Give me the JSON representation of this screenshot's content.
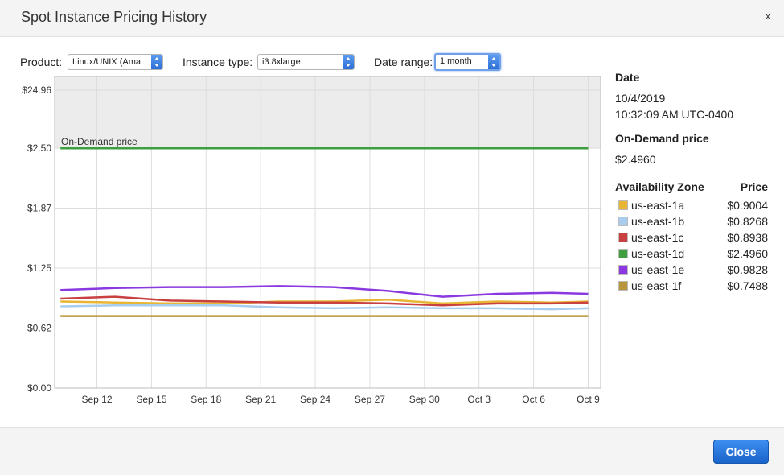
{
  "dialog": {
    "title": "Spot Instance Pricing History",
    "close_glyph": "x"
  },
  "controls": {
    "product": {
      "label": "Product:",
      "value": "Linux/UNIX (Ama"
    },
    "instance_type": {
      "label": "Instance type:",
      "value": "i3.8xlarge"
    },
    "date_range": {
      "label": "Date range:",
      "value": "1 month"
    }
  },
  "details": {
    "date_heading": "Date",
    "date": "10/4/2019",
    "time": "10:32:09 AM UTC-0400",
    "on_demand_heading": "On-Demand price",
    "on_demand_price": "$2.4960",
    "az_heading": "Availability Zone",
    "price_heading": "Price",
    "zones": [
      {
        "name": "us-east-1a",
        "price": "$0.9004",
        "color": "#e8b534"
      },
      {
        "name": "us-east-1b",
        "price": "$0.8268",
        "color": "#a9cdee"
      },
      {
        "name": "us-east-1c",
        "price": "$0.8938",
        "color": "#c94040"
      },
      {
        "name": "us-east-1d",
        "price": "$2.4960",
        "color": "#3f9e3f"
      },
      {
        "name": "us-east-1e",
        "price": "$0.9828",
        "color": "#8a38e0"
      },
      {
        "name": "us-east-1f",
        "price": "$0.7488",
        "color": "#b8963c"
      }
    ]
  },
  "footer": {
    "close_label": "Close"
  },
  "chart_data": {
    "type": "line",
    "ylim": [
      0,
      3.32
    ],
    "y_scale": "piecewise: linear 0–2.496 below the on-demand line, compressed 2.496–24.96 above it",
    "y_ticks": [
      {
        "value": 0,
        "label": "$0.00"
      },
      {
        "value": 0.624,
        "label": "$0.62"
      },
      {
        "value": 1.248,
        "label": "$1.25"
      },
      {
        "value": 1.872,
        "label": "$1.87"
      },
      {
        "value": 2.496,
        "label": "$2.50"
      },
      {
        "value": 24.96,
        "label": "$24.96"
      }
    ],
    "x_ticks": [
      "Sep 12",
      "Sep 15",
      "Sep 18",
      "Sep 21",
      "Sep 24",
      "Sep 27",
      "Sep 30",
      "Oct 3",
      "Oct 6",
      "Oct 9"
    ],
    "x_range": [
      "Sep 10",
      "Oct 9"
    ],
    "annotation": "On-Demand price",
    "grid": true,
    "x": [
      "Sep 10",
      "Sep 13",
      "Sep 16",
      "Sep 19",
      "Sep 22",
      "Sep 25",
      "Sep 28",
      "Oct 1",
      "Oct 4",
      "Oct 7",
      "Oct 9"
    ],
    "series": [
      {
        "name": "us-east-1a",
        "color": "#e8b534",
        "values": [
          0.9,
          0.89,
          0.88,
          0.88,
          0.9,
          0.9,
          0.92,
          0.88,
          0.9,
          0.89,
          0.9
        ]
      },
      {
        "name": "us-east-1b",
        "color": "#a9cdee",
        "values": [
          0.85,
          0.86,
          0.86,
          0.86,
          0.84,
          0.83,
          0.84,
          0.83,
          0.83,
          0.82,
          0.83
        ]
      },
      {
        "name": "us-east-1c",
        "color": "#c94040",
        "values": [
          0.93,
          0.95,
          0.91,
          0.9,
          0.89,
          0.89,
          0.88,
          0.86,
          0.88,
          0.88,
          0.89
        ]
      },
      {
        "name": "us-east-1d",
        "color": "#3f9e3f",
        "values": [
          2.496,
          2.496,
          2.496,
          2.496,
          2.496,
          2.496,
          2.496,
          2.496,
          2.496,
          2.496,
          2.496
        ]
      },
      {
        "name": "us-east-1e",
        "color": "#8a38e0",
        "values": [
          1.02,
          1.04,
          1.05,
          1.05,
          1.06,
          1.05,
          1.01,
          0.95,
          0.98,
          0.99,
          0.98
        ]
      },
      {
        "name": "us-east-1f",
        "color": "#b8963c",
        "values": [
          0.7488,
          0.7488,
          0.7488,
          0.7488,
          0.7488,
          0.7488,
          0.7488,
          0.7488,
          0.7488,
          0.7488,
          0.7488
        ]
      }
    ]
  }
}
